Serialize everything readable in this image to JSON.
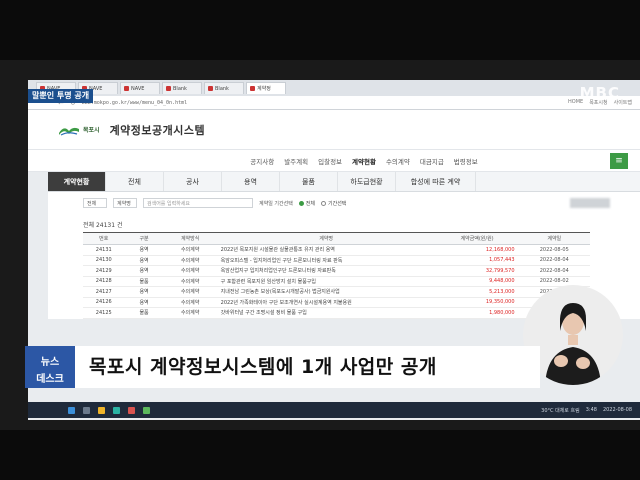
{
  "overlay": {
    "program_tag": "말뿐인 투명 공개",
    "broadcaster_logo": "MBC",
    "caption_box_line1": "뉴스",
    "caption_box_line2": "데스크",
    "caption_text": "목포시 계약정보시스템에 1개 사업만 공개"
  },
  "browser": {
    "tabs": [
      "NAVE",
      "NAVE",
      "NAVE",
      "Blank",
      "Blank",
      "계약정"
    ],
    "url": "www.mokpo.go.kr/www/menu_04_0n.html",
    "right_items": [
      "HOME",
      "목포시청",
      "사이트맵"
    ]
  },
  "site": {
    "logo_text": "목포시",
    "title": "계약정보공개시스템",
    "top_menu": [
      "공지사항",
      "발주계획",
      "입찰정보",
      "계약현황",
      "수의계약",
      "대금지급",
      "법령정보"
    ],
    "active_menu_index": 3,
    "menu_icon": "hamburger-icon"
  },
  "subtabs": [
    "계약현황",
    "전체",
    "공사",
    "용역",
    "물품",
    "하도급현황",
    "합성에 따른 계약"
  ],
  "filter": {
    "select1": "전체",
    "select2": "계약명",
    "search_placeholder": "검색어를 입력하세요",
    "period_label": "계약일 기간선택",
    "radio1": "전체",
    "radio2": "기간선택"
  },
  "count_text": "전체 24131 건",
  "table": {
    "headers": [
      "번호",
      "구분",
      "계약방식",
      "계약명",
      "계약금액(원/원)",
      "계약일"
    ],
    "rows": [
      [
        "24131",
        "용역",
        "수의계약",
        "2022년 목포지원 시설물관 실물관통조 유지 관리 용역",
        "12,168,000",
        "2022-08-05"
      ],
      [
        "24130",
        "용역",
        "수의계약",
        "옥암오피스텔 - 입지처리업인 구단 드론모니터링 자료 판독",
        "1,057,443",
        "2022-08-04"
      ],
      [
        "24129",
        "용역",
        "수의계약",
        "옥암산업지구 입지처리업인구단 드론모니터링 자료판독",
        "32,799,570",
        "2022-08-04"
      ],
      [
        "24128",
        "물품",
        "수의계약",
        "구 포함관련 목포지원 임산방지 설치 물품구입",
        "9,448,000",
        "2022-08-02"
      ],
      [
        "24127",
        "용역",
        "수의계약",
        "지내전남 그린농촌 보상(목포도시개발공사) 법금지원사업",
        "5,213,000",
        "2022-08-02"
      ],
      [
        "24126",
        "용역",
        "수의계약",
        "2022년 가족화테이아 구단 보조개연사 실시설계용역 지불용원",
        "19,350,000",
        "2022-08-01"
      ],
      [
        "24125",
        "물품",
        "수의계약",
        "갓바위터널 구간 조명시설 정비 물품 구입",
        "1,980,000",
        "2022-08-01"
      ]
    ]
  },
  "taskbar": {
    "weather": "30°C 대체로 흐림",
    "time": "3:48",
    "date": "2022-08-08"
  },
  "colors": {
    "brand_green": "#3d9b45",
    "caption_blue": "#2c57a5",
    "tag_blue": "#1b4f8e",
    "amount_red": "#dd2222"
  }
}
